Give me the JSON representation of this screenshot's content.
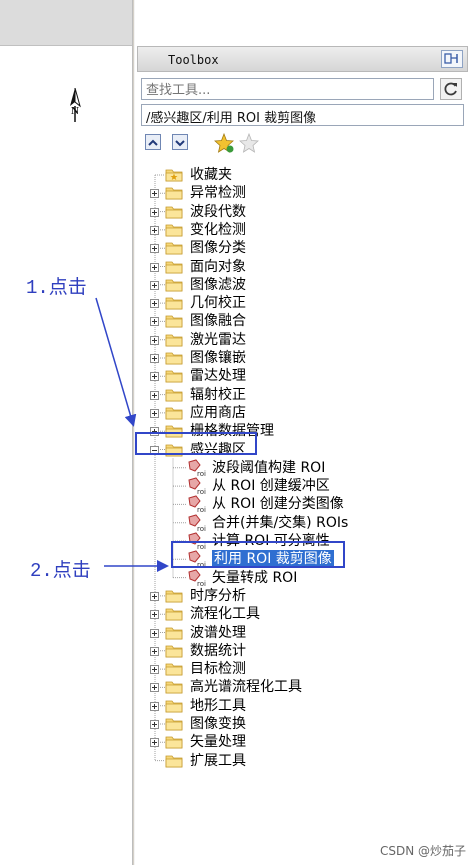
{
  "toolbox": {
    "title": "Toolbox",
    "search_placeholder": "查找工具...",
    "path": "/感兴趣区/利用 ROI 裁剪图像",
    "tree": {
      "folders_before": [
        "收藏夹",
        "异常检测",
        "波段代数",
        "变化检测",
        "图像分类",
        "面向对象",
        "图像滤波",
        "几何校正",
        "图像融合",
        "激光雷达",
        "图像镶嵌",
        "雷达处理",
        "辐射校正",
        "应用商店",
        "栅格数据管理"
      ],
      "expanded_folder": "感兴趣区",
      "roi_tools": [
        "波段阈值构建 ROI",
        "从 ROI 创建缓冲区",
        "从 ROI 创建分类图像",
        "合并(并集/交集) ROIs",
        "计算 ROI 可分离性",
        "利用 ROI 裁剪图像",
        "矢量转成 ROI"
      ],
      "selected_tool": "利用 ROI 裁剪图像",
      "folders_after": [
        "时序分析",
        "流程化工具",
        "波谱处理",
        "数据统计",
        "目标检测",
        "高光谱流程化工具",
        "地形工具",
        "图像变换",
        "矢量处理",
        "扩展工具"
      ]
    }
  },
  "annotations": {
    "step1": "1.点击",
    "step2": "2.点击",
    "highlight_color": "#3146c8"
  },
  "watermark": "CSDN @炒茄子"
}
